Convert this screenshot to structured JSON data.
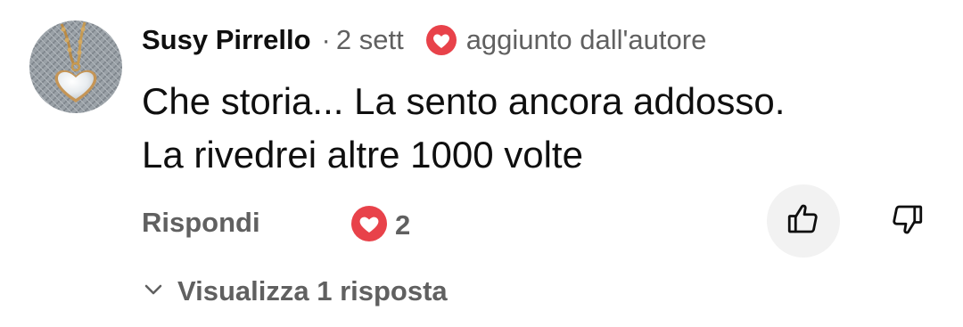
{
  "comment": {
    "author": "Susy Pirrello",
    "separator": "·",
    "time": "2 sett",
    "hearted_by_author_label": "aggiunto dall'autore",
    "text_lines": [
      "Che storia... La sento ancora addosso.",
      "La rivedrei altre 1000 volte"
    ],
    "reply_label": "Rispondi",
    "love_count": "2",
    "view_replies_label": "Visualizza 1 risposta"
  },
  "icons": {
    "avatar": "heart-pendant-avatar",
    "badge": "heart-badge-icon",
    "love": "heart-reaction-icon",
    "like": "thumb-up-icon",
    "dislike": "thumb-down-icon",
    "expand": "chevron-down-icon"
  },
  "colors": {
    "heart_red": "#e8424a",
    "text_primary": "#0f0f0f",
    "text_secondary": "#606060",
    "button_bg": "#f2f2f2"
  }
}
